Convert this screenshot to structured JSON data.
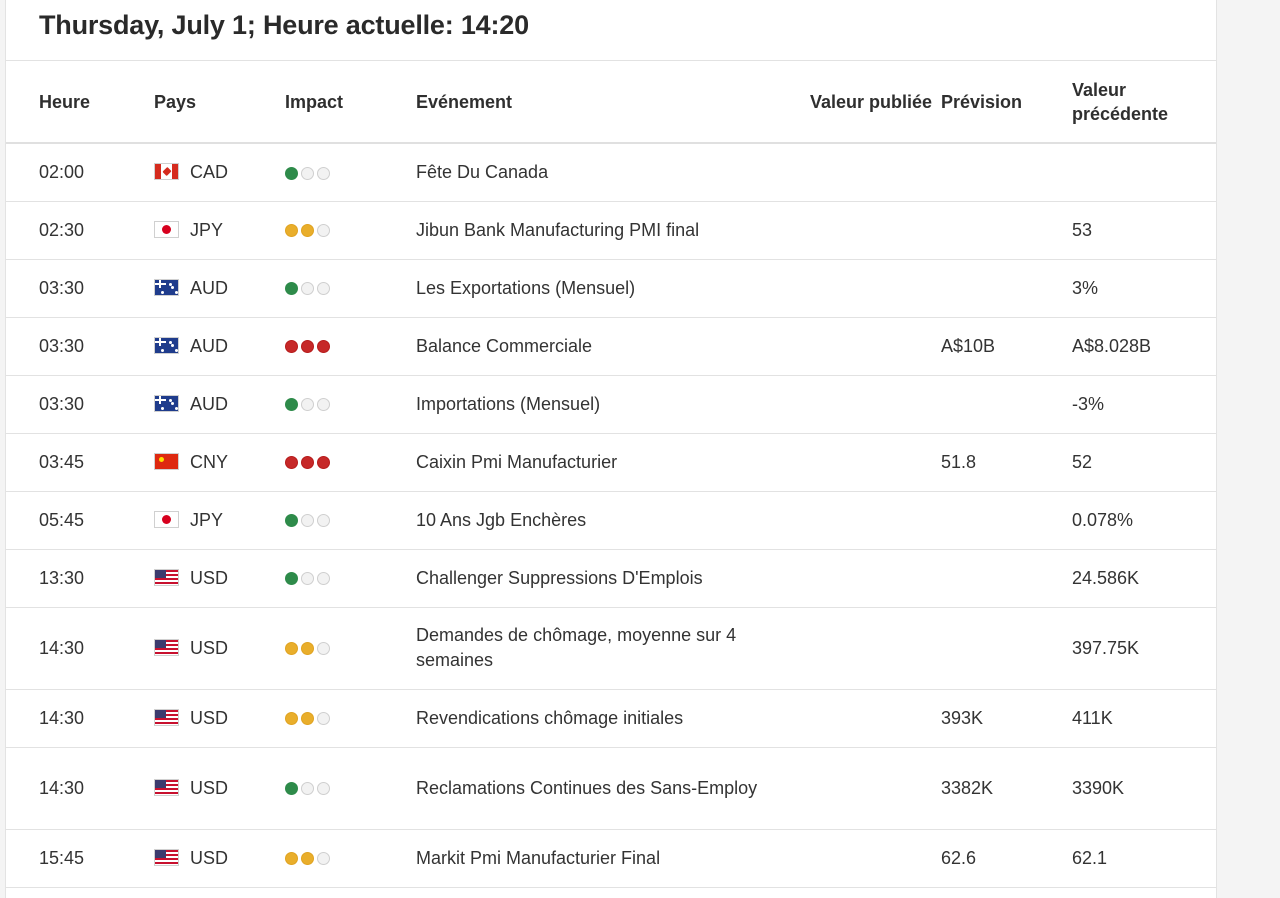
{
  "header": {
    "title": "Thursday, July 1; Heure actuelle: 14:20"
  },
  "columns": {
    "time": "Heure",
    "country": "Pays",
    "impact": "Impact",
    "event": "Evénement",
    "actual": "Valeur publiée",
    "forecast": "Prévision",
    "previous": "Valeur précédente"
  },
  "impact_colors": {
    "low": "#2e8b4a",
    "medium": "#e9ae2b",
    "high": "#c62828"
  },
  "rows": [
    {
      "time": "02:00",
      "flag": "flag-canada-icon",
      "country": "CAD",
      "impact": "low",
      "event": "Fête Du Canada",
      "actual": "",
      "forecast": "",
      "previous": ""
    },
    {
      "time": "02:30",
      "flag": "flag-japan-icon",
      "country": "JPY",
      "impact": "medium",
      "event": "Jibun Bank Manufacturing PMI final",
      "actual": "",
      "forecast": "",
      "previous": "53"
    },
    {
      "time": "03:30",
      "flag": "flag-australia-icon",
      "country": "AUD",
      "impact": "low",
      "event": "Les Exportations (Mensuel)",
      "actual": "",
      "forecast": "",
      "previous": "3%"
    },
    {
      "time": "03:30",
      "flag": "flag-australia-icon",
      "country": "AUD",
      "impact": "high",
      "event": "Balance Commerciale",
      "actual": "",
      "forecast": "A$10B",
      "previous": "A$8.028B"
    },
    {
      "time": "03:30",
      "flag": "flag-australia-icon",
      "country": "AUD",
      "impact": "low",
      "event": "Importations (Mensuel)",
      "actual": "",
      "forecast": "",
      "previous": "-3%"
    },
    {
      "time": "03:45",
      "flag": "flag-china-icon",
      "country": "CNY",
      "impact": "high",
      "event": "Caixin Pmi Manufacturier",
      "actual": "",
      "forecast": "51.8",
      "previous": "52"
    },
    {
      "time": "05:45",
      "flag": "flag-japan-icon",
      "country": "JPY",
      "impact": "low",
      "event": "10 Ans Jgb Enchères",
      "actual": "",
      "forecast": "",
      "previous": "0.078%"
    },
    {
      "time": "13:30",
      "flag": "flag-usa-icon",
      "country": "USD",
      "impact": "low",
      "event": "Challenger Suppressions D'Emplois",
      "actual": "",
      "forecast": "",
      "previous": "24.586K"
    },
    {
      "time": "14:30",
      "flag": "flag-usa-icon",
      "country": "USD",
      "impact": "medium",
      "event": "Demandes de chômage, moyenne sur 4 semaines",
      "actual": "",
      "forecast": "",
      "previous": "397.75K"
    },
    {
      "time": "14:30",
      "flag": "flag-usa-icon",
      "country": "USD",
      "impact": "medium",
      "event": "Revendications chômage initiales",
      "actual": "",
      "forecast": "393K",
      "previous": "411K"
    },
    {
      "time": "14:30",
      "flag": "flag-usa-icon",
      "country": "USD",
      "impact": "low",
      "event": "Reclamations Continues des Sans-Employ",
      "actual": "",
      "forecast": "3382K",
      "previous": "3390K"
    },
    {
      "time": "15:45",
      "flag": "flag-usa-icon",
      "country": "USD",
      "impact": "medium",
      "event": "Markit Pmi Manufacturier Final",
      "actual": "",
      "forecast": "62.6",
      "previous": "62.1"
    }
  ]
}
